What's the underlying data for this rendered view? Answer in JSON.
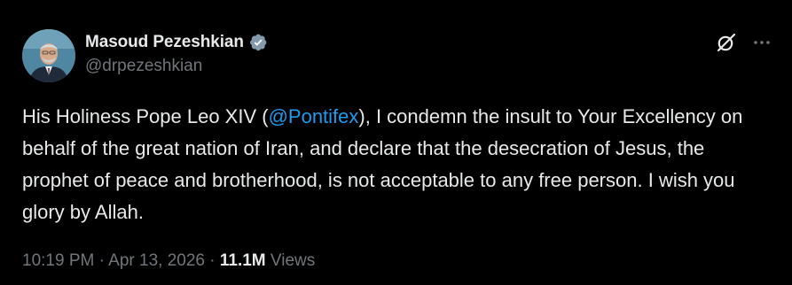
{
  "author": {
    "display_name": "Masoud Pezeshkian",
    "handle": "@drpezeshkian",
    "verified_icon": "verified-badge-icon"
  },
  "actions": {
    "grok_icon": "grok-icon",
    "more_icon": "more-icon"
  },
  "post": {
    "text_before": "His Holiness Pope Leo XIV (",
    "mention": "@Pontifex",
    "text_after": "), I condemn the insult to Your Excellency on behalf of the great nation of Iran, and declare that the desecration of Jesus, the prophet of peace and brotherhood, is not acceptable to any free person. I wish you glory by Allah."
  },
  "meta": {
    "time": "10:19 PM",
    "sep1": " · ",
    "date": "Apr 13, 2026",
    "sep2": " · ",
    "views_count": "11.1M",
    "views_label": " Views"
  },
  "colors": {
    "background": "#000000",
    "text": "#e7e9ea",
    "secondary": "#71767b",
    "link": "#1d9bf0",
    "badge": "#829aab"
  }
}
